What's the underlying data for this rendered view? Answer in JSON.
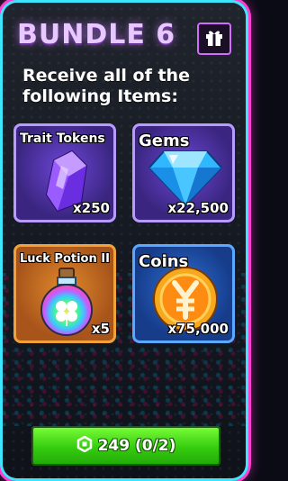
{
  "bundle": {
    "title": "BUNDLE 6",
    "subtitle": "Receive all of the following Items:",
    "gift_icon": "gift-icon"
  },
  "items": [
    {
      "name": "Trait Tokens",
      "quantity": "x250",
      "icon": "crystal-icon",
      "frame_color": "#b89bff"
    },
    {
      "name": "Gems",
      "quantity": "x22,500",
      "icon": "diamond-icon",
      "frame_color": "#b89bff"
    },
    {
      "name": "Luck Potion II",
      "quantity": "x5",
      "icon": "potion-icon",
      "frame_color": "#f0a13a"
    },
    {
      "name": "Coins",
      "quantity": "x75,000",
      "icon": "yen-coin-icon",
      "frame_color": "#5aa8ff"
    }
  ],
  "purchase": {
    "price_label": "249 (0/2)",
    "currency_icon": "robux-icon",
    "button_color": "#35cc0f"
  },
  "colors": {
    "outer_glow": "#ff3fd0",
    "inner_border": "#3de6ff",
    "title": "#e7c8ff"
  }
}
